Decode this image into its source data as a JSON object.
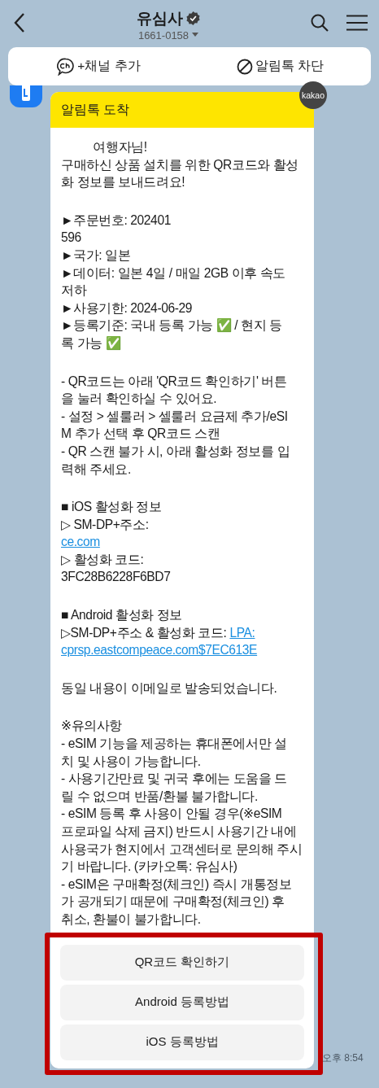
{
  "header": {
    "title": "유심사",
    "phone": "1661-0158"
  },
  "banner": {
    "actions": [
      {
        "kind": "channel",
        "label": "+채널 추가"
      },
      {
        "kind": "block",
        "label": "알림톡 차단"
      }
    ]
  },
  "message": {
    "badge": "kakao",
    "heading": "알림톡 도착",
    "paragraphs": [
      [
        {
          "text": "          여행자님!"
        },
        {
          "text": "구매하신 상품 설치를 위한 QR코드와 활성"
        },
        {
          "text": "화 정보를 보내드려요!"
        }
      ],
      [
        {
          "text": "►주문번호: 202401"
        },
        {
          "text": "596"
        },
        {
          "text": "►국가: 일본"
        },
        {
          "text": "►데이터: 일본 4일 / 매일 2GB 이후 속도"
        },
        {
          "text": "저하"
        },
        {
          "text": "►사용기한: 2024-06-29"
        },
        {
          "text": "►등록기준: 국내 등록 가능 ✅ / 현지 등"
        },
        {
          "text": "록 가능 ✅"
        }
      ],
      [
        {
          "text": "- QR코드는 아래 'QR코드 확인하기' 버튼"
        },
        {
          "text": "을 눌러 확인하실 수 있어요."
        },
        {
          "text": "- 설정 > 셀룰러 > 셀룰러 요금제 추가/eSI"
        },
        {
          "text": "M 추가 선택 후 QR코드 스캔"
        },
        {
          "text": "- QR 스캔 불가 시, 아래 활성화 정보를 입"
        },
        {
          "text": "력해 주세요."
        }
      ],
      [
        {
          "text": "■ iOS 활성화 정보"
        },
        {
          "text": "▷ SM-DP+주소:"
        },
        {
          "link": "ce.com"
        },
        {
          "text": "▷ 활성화 코드:"
        },
        {
          "text": "3FC28B6228F6BD7"
        }
      ],
      [
        {
          "text": "■ Android 활성화 정보"
        },
        {
          "text": "▷SM-DP+주소 & 활성화 코드: ",
          "link": "LPA:"
        },
        {
          "link": "cprsp.eastcompeace.com$7EC613E"
        }
      ],
      [
        {
          "text": "동일 내용이 이메일로 발송되었습니다."
        }
      ],
      [
        {
          "text": "※유의사항"
        },
        {
          "text": "- eSIM 기능을 제공하는 휴대폰에서만 설"
        },
        {
          "text": "치 및 사용이 가능합니다."
        },
        {
          "text": "- 사용기간만료 및 귀국 후에는 도움을 드"
        },
        {
          "text": "릴 수 없으며 반품/환불 불가합니다."
        },
        {
          "text": "- eSIM 등록 후 사용이 안될 경우(※eSIM"
        },
        {
          "text": "프로파일 삭제 금지) 반드시 사용기간 내에"
        },
        {
          "text": "사용국가 현지에서 고객센터로 문의해 주시"
        },
        {
          "text": "기 바랍니다. (카카오톡: 유심사)"
        },
        {
          "text": "- eSIM은 구매확정(체크인) 즉시 개통정보"
        },
        {
          "text": "가 공개되기 때문에 구매확정(체크인) 후"
        },
        {
          "text": "취소, 환불이 불가합니다."
        }
      ]
    ],
    "buttons": [
      "QR코드 확인하기",
      "Android 등록방법",
      "iOS 등록방법"
    ],
    "highlighted": true,
    "time": "오후 8:54"
  }
}
